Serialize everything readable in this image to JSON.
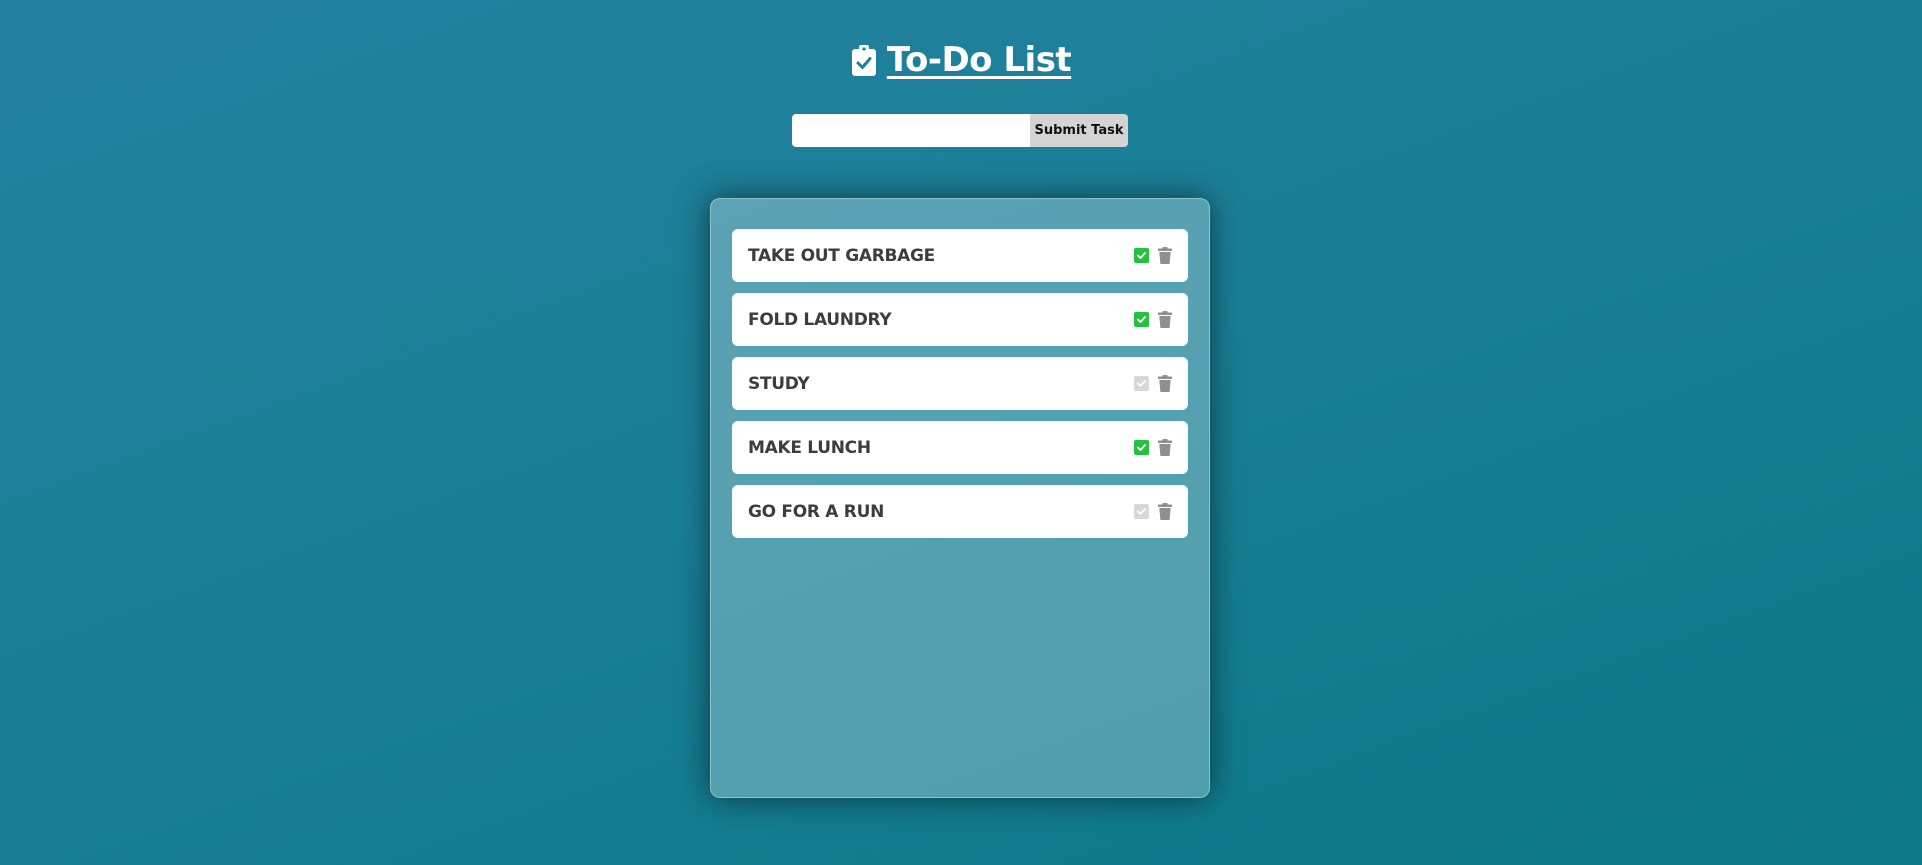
{
  "header": {
    "title": "To-Do List",
    "icon": "clipboard-check-icon"
  },
  "form": {
    "input_value": "",
    "input_placeholder": "",
    "submit_label": "Submit Task"
  },
  "colors": {
    "completed": "#22c33a",
    "pending": "#d7d7d7",
    "trash": "#8f8f8f"
  },
  "tasks": [
    {
      "text": "TAKE OUT GARBAGE",
      "completed": true
    },
    {
      "text": "FOLD LAUNDRY",
      "completed": true
    },
    {
      "text": "STUDY",
      "completed": false
    },
    {
      "text": "MAKE LUNCH",
      "completed": true
    },
    {
      "text": "GO FOR A RUN",
      "completed": false
    }
  ]
}
